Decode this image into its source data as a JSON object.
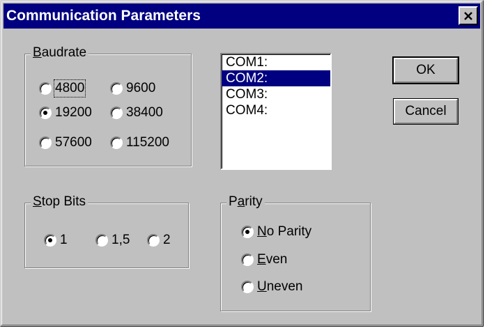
{
  "window": {
    "title": "Communication Parameters",
    "close_glyph": "✕"
  },
  "baudrate": {
    "legend_mnemonic": "B",
    "legend_rest": "audrate",
    "options": [
      {
        "label": "4800",
        "checked": false
      },
      {
        "label": "9600",
        "checked": false
      },
      {
        "label": "19200",
        "checked": true
      },
      {
        "label": "38400",
        "checked": false
      },
      {
        "label": "57600",
        "checked": false
      },
      {
        "label": "115200",
        "checked": false
      }
    ]
  },
  "ports": {
    "items": [
      "COM1:",
      "COM2:",
      "COM3:",
      "COM4:"
    ],
    "selected": "COM2:"
  },
  "buttons": {
    "ok": "OK",
    "cancel": "Cancel"
  },
  "stop_bits": {
    "legend_mnemonic": "S",
    "legend_rest": "top Bits",
    "options": [
      {
        "label": "1",
        "checked": true
      },
      {
        "label": "1,5",
        "checked": false
      },
      {
        "label": "2",
        "checked": false
      }
    ]
  },
  "parity": {
    "legend_pre": "P",
    "legend_mnemonic": "a",
    "legend_rest": "rity",
    "options": [
      {
        "mnemonic": "N",
        "rest": "o Parity",
        "checked": true
      },
      {
        "mnemonic": "E",
        "rest": "ven",
        "checked": false
      },
      {
        "mnemonic": "U",
        "rest": "neven",
        "checked": false
      }
    ]
  }
}
